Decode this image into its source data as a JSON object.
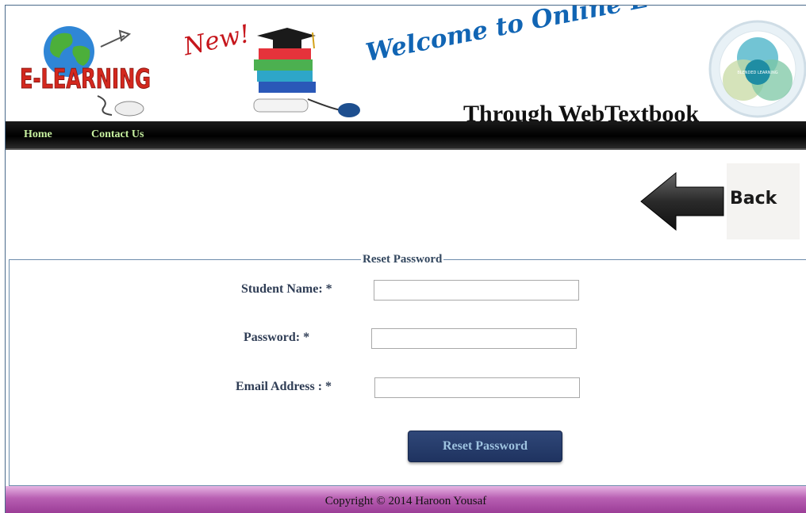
{
  "header": {
    "logo_text": "E-LEARNING",
    "new_tag": "New!",
    "welcome_text": "Welcome to Online E-Learning",
    "subtitle": "Through WebTextbook",
    "blend_logo_text": "BLENDED LEARNING"
  },
  "nav": {
    "items": [
      {
        "label": "Home"
      },
      {
        "label": "Contact Us"
      }
    ]
  },
  "back_button": {
    "label": "Back"
  },
  "form": {
    "legend": "Reset Password",
    "fields": [
      {
        "label": "Student Name: *",
        "value": "",
        "placeholder": ""
      },
      {
        "label": "Password: *",
        "value": "",
        "placeholder": ""
      },
      {
        "label": "Email Address : *",
        "value": "",
        "placeholder": ""
      }
    ],
    "submit_label": "Reset Password"
  },
  "footer": {
    "copyright": "Copyright © 2014 Haroon Yousaf"
  },
  "colors": {
    "nav_bg": "#000000",
    "nav_link": "#c7f0a0",
    "welcome_blue": "#1165b4",
    "button_bg": "#2a4070",
    "footer_purple": "#b85fb2"
  }
}
